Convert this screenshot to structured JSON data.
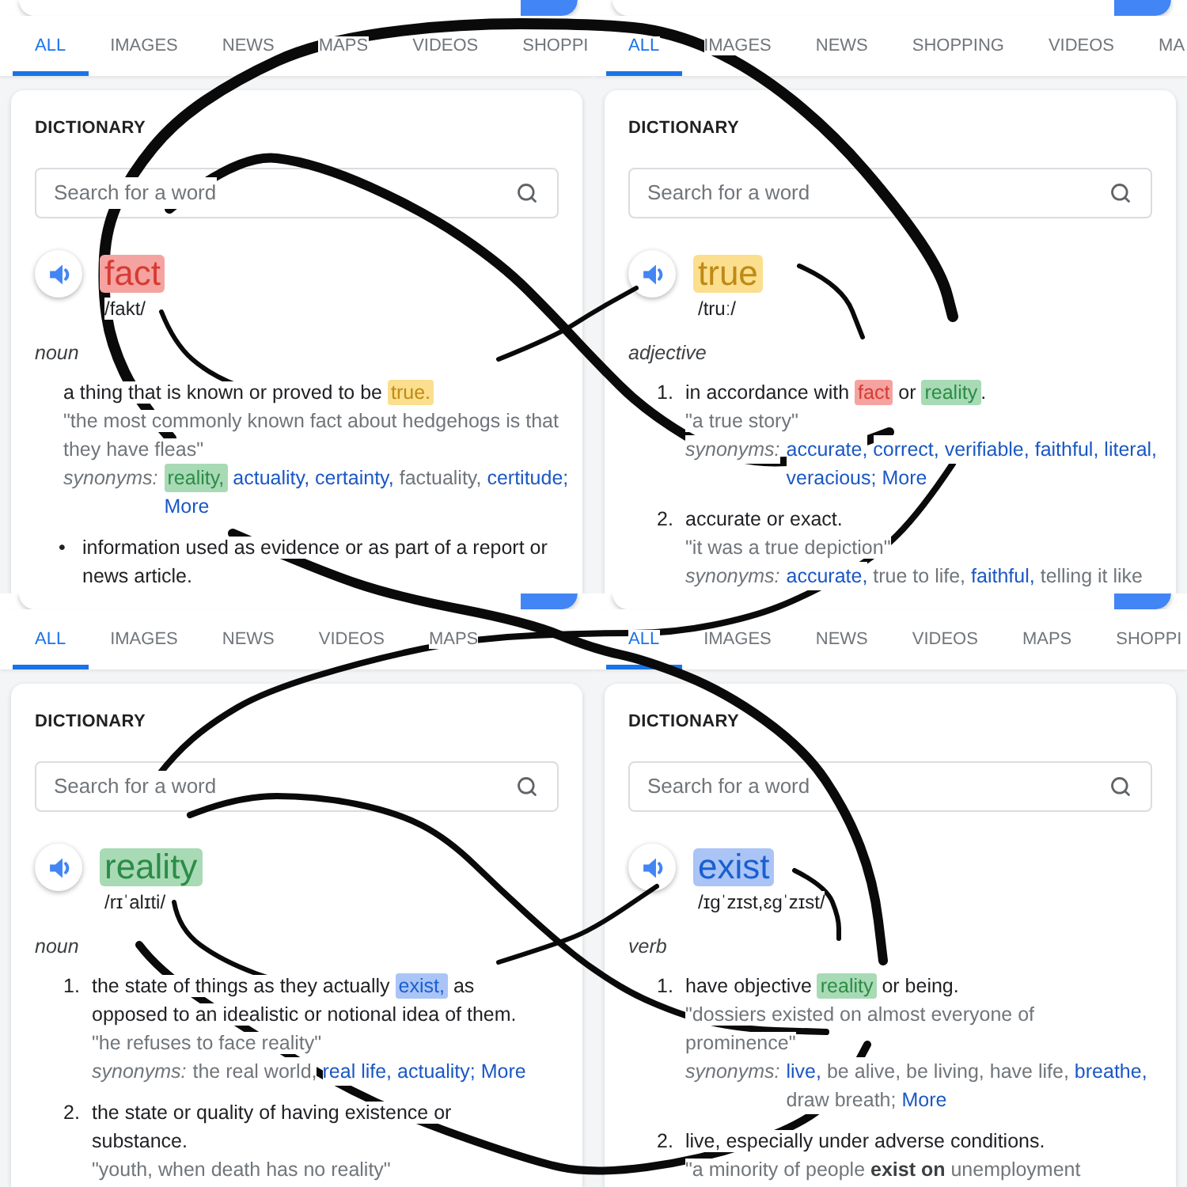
{
  "panels": [
    {
      "tabs": [
        {
          "label": "ALL",
          "selected": true
        },
        {
          "label": "IMAGES",
          "selected": false
        },
        {
          "label": "NEWS",
          "selected": false
        },
        {
          "label": "MAPS",
          "selected": false
        },
        {
          "label": "VIDEOS",
          "selected": false
        },
        {
          "label": "SHOPPI",
          "selected": false
        }
      ],
      "section_title": "DICTIONARY",
      "search": {
        "placeholder": "Search for a word"
      },
      "headword": {
        "text": "fact",
        "color": "#f5a3a0"
      },
      "pronunciation": "/fakt/",
      "part_of_speech": "noun",
      "senses": [
        {
          "kind": "plain",
          "definition": [
            {
              "text": "a thing that is known or proved to be "
            },
            {
              "text": "true.",
              "color": "#fbdf8f"
            }
          ],
          "example": "\"the most commonly known fact about hedgehogs is that they have fleas\"",
          "synonyms": {
            "label": "synonyms:",
            "items": [
              {
                "text": "reality,",
                "kind": "link",
                "color": "#a8dab5"
              },
              {
                "text": "actuality,",
                "kind": "link"
              },
              {
                "text": "certainty,",
                "kind": "link"
              },
              {
                "text": "factuality,",
                "kind": "plain"
              },
              {
                "text": "certitude;",
                "kind": "link"
              },
              {
                "text": "More",
                "kind": "link"
              }
            ]
          }
        },
        {
          "kind": "bullet",
          "marker": "•",
          "definition": [
            {
              "text": "information used as evidence or as part of a report or news article."
            }
          ]
        }
      ]
    },
    {
      "tabs": [
        {
          "label": "ALL",
          "selected": true
        },
        {
          "label": "IMAGES",
          "selected": false
        },
        {
          "label": "NEWS",
          "selected": false
        },
        {
          "label": "SHOPPING",
          "selected": false
        },
        {
          "label": "VIDEOS",
          "selected": false
        },
        {
          "label": "MA",
          "selected": false
        }
      ],
      "section_title": "DICTIONARY",
      "search": {
        "placeholder": "Search for a word"
      },
      "headword": {
        "text": "true",
        "color": "#fbdf8f"
      },
      "pronunciation": "/truː/",
      "part_of_speech": "adjective",
      "senses": [
        {
          "kind": "numbered",
          "marker": "1.",
          "definition": [
            {
              "text": "in accordance with "
            },
            {
              "text": "fact",
              "color": "#f5a3a0"
            },
            {
              "text": " or "
            },
            {
              "text": "reality",
              "color": "#a8dab5"
            },
            {
              "text": "."
            }
          ],
          "example": "\"a true story\"",
          "synonyms": {
            "label": "synonyms:",
            "items": [
              {
                "text": "accurate,",
                "kind": "link"
              },
              {
                "text": "correct,",
                "kind": "link"
              },
              {
                "text": "verifiable,",
                "kind": "link"
              },
              {
                "text": "faithful,",
                "kind": "link"
              },
              {
                "text": "literal,",
                "kind": "link"
              },
              {
                "text": "veracious;",
                "kind": "link"
              },
              {
                "text": "More",
                "kind": "link"
              }
            ]
          }
        },
        {
          "kind": "numbered",
          "marker": "2.",
          "definition": [
            {
              "text": "accurate or exact."
            }
          ],
          "example": "\"it was a true depiction\"",
          "synonyms": {
            "label": "synonyms:",
            "items": [
              {
                "text": "accurate,",
                "kind": "link"
              },
              {
                "text": "true to life,",
                "kind": "plain"
              },
              {
                "text": "faithful,",
                "kind": "link"
              },
              {
                "text": "telling it like",
                "kind": "plain"
              }
            ]
          }
        }
      ]
    },
    {
      "tabs": [
        {
          "label": "ALL",
          "selected": true
        },
        {
          "label": "IMAGES",
          "selected": false
        },
        {
          "label": "NEWS",
          "selected": false
        },
        {
          "label": "VIDEOS",
          "selected": false
        },
        {
          "label": "MAPS",
          "selected": false
        }
      ],
      "section_title": "DICTIONARY",
      "search": {
        "placeholder": "Search for a word"
      },
      "headword": {
        "text": "reality",
        "color": "#a8dab5"
      },
      "pronunciation": "/rɪˈalɪti/",
      "part_of_speech": "noun",
      "senses": [
        {
          "kind": "numbered",
          "marker": "1.",
          "definition": [
            {
              "text": "the state of things as they actually "
            },
            {
              "text": "exist,",
              "color": "#aac4f6"
            },
            {
              "text": " as opposed to an idealistic or notional idea of them."
            }
          ],
          "example": "\"he refuses to face reality\"",
          "synonyms": {
            "label": "synonyms:",
            "items": [
              {
                "text": "the real world,",
                "kind": "plain"
              },
              {
                "text": "real life,",
                "kind": "link"
              },
              {
                "text": "actuality;",
                "kind": "link"
              },
              {
                "text": "More",
                "kind": "link"
              }
            ]
          }
        },
        {
          "kind": "numbered",
          "marker": "2.",
          "definition": [
            {
              "text": "the state or quality of having existence or substance."
            }
          ],
          "example": "\"youth, when death has no reality\""
        }
      ]
    },
    {
      "tabs": [
        {
          "label": "ALL",
          "selected": true
        },
        {
          "label": "IMAGES",
          "selected": false
        },
        {
          "label": "NEWS",
          "selected": false
        },
        {
          "label": "VIDEOS",
          "selected": false
        },
        {
          "label": "MAPS",
          "selected": false
        },
        {
          "label": "SHOPPI",
          "selected": false
        }
      ],
      "section_title": "DICTIONARY",
      "search": {
        "placeholder": "Search for a word"
      },
      "headword": {
        "text": "exist",
        "color": "#aac4f6"
      },
      "pronunciation": "/ɪɡˈzɪst,ɛɡˈzɪst/",
      "part_of_speech": "verb",
      "senses": [
        {
          "kind": "numbered",
          "marker": "1.",
          "definition": [
            {
              "text": "have objective "
            },
            {
              "text": "reality",
              "color": "#a8dab5"
            },
            {
              "text": " or being."
            }
          ],
          "example": "\"dossiers existed on almost everyone of prominence\"",
          "synonyms": {
            "label": "synonyms:",
            "items": [
              {
                "text": "live,",
                "kind": "link"
              },
              {
                "text": "be alive,",
                "kind": "plain"
              },
              {
                "text": "be living,",
                "kind": "plain"
              },
              {
                "text": "have life,",
                "kind": "plain"
              },
              {
                "text": "breathe,",
                "kind": "link"
              },
              {
                "text": "draw breath;",
                "kind": "plain"
              },
              {
                "text": "More",
                "kind": "link"
              }
            ]
          }
        },
        {
          "kind": "numbered",
          "marker": "2.",
          "definition": [
            {
              "text": "live, especially under adverse conditions."
            }
          ],
          "example": "\"a minority of people **exist on** unemployment"
        }
      ]
    }
  ]
}
